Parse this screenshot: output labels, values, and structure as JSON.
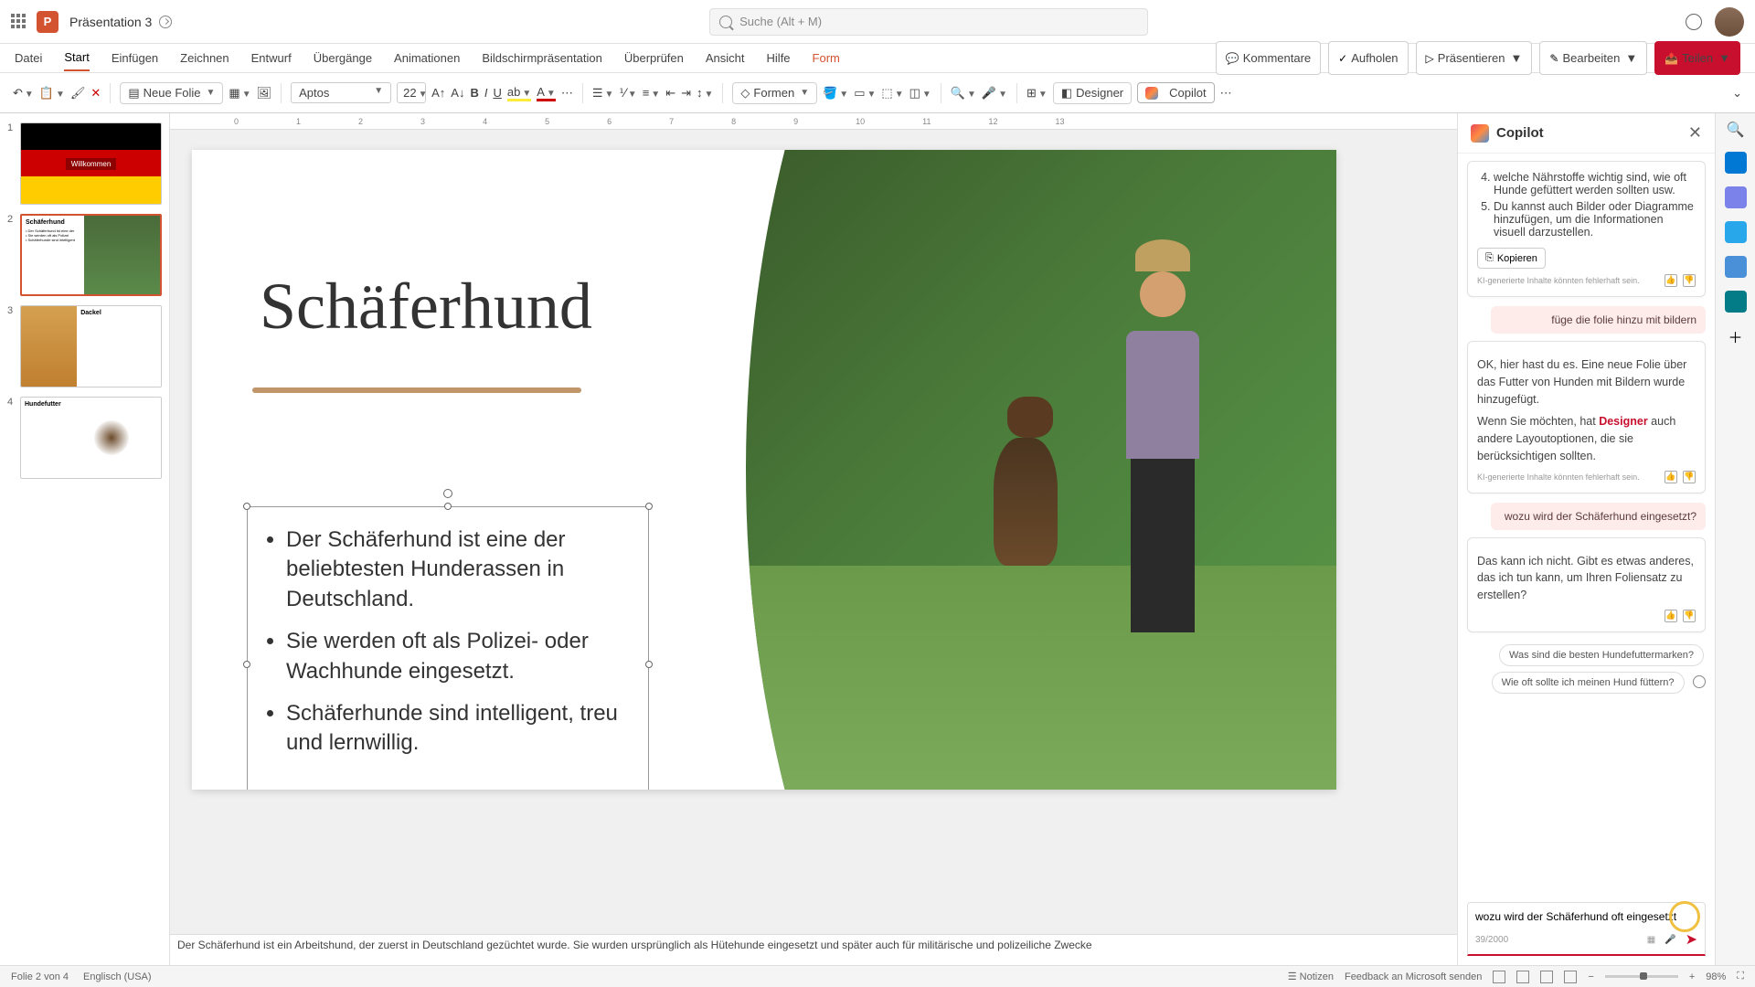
{
  "title": {
    "doc_name": "Präsentation 3",
    "search_placeholder": "Suche (Alt + M)"
  },
  "ribbon": {
    "tabs": [
      "Datei",
      "Start",
      "Einfügen",
      "Zeichnen",
      "Entwurf",
      "Übergänge",
      "Animationen",
      "Bildschirmpräsentation",
      "Überprüfen",
      "Ansicht",
      "Hilfe",
      "Form"
    ],
    "active_index": 1,
    "right": {
      "kommentare": "Kommentare",
      "aufholen": "Aufholen",
      "praesentieren": "Präsentieren",
      "bearbeiten": "Bearbeiten",
      "teilen": "Teilen"
    }
  },
  "toolbar": {
    "neue_folie": "Neue Folie",
    "font_name": "Aptos",
    "font_size": "22",
    "formen": "Formen",
    "designer": "Designer",
    "copilot": "Copilot"
  },
  "ruler": [
    "0",
    "1",
    "2",
    "3",
    "4",
    "5",
    "6",
    "7",
    "8",
    "9",
    "10",
    "11",
    "12",
    "13"
  ],
  "thumbs": {
    "t1": {
      "num": "1",
      "label": "Willkommen"
    },
    "t2": {
      "num": "2",
      "title": "Schäferhund"
    },
    "t3": {
      "num": "3",
      "title": "Dackel"
    },
    "t4": {
      "num": "4",
      "title": "Hundefutter"
    }
  },
  "slide": {
    "title": "Schäferhund",
    "bullets": [
      "Der Schäferhund ist eine der beliebtesten Hunderassen in Deutschland.",
      "Sie werden oft als Polizei- oder Wachhunde eingesetzt.",
      "Schäferhunde sind intelligent, treu und lernwillig."
    ],
    "notes": "Der Schäferhund ist ein Arbeitshund, der zuerst in Deutschland gezüchtet wurde. Sie wurden ursprünglich als Hütehunde eingesetzt und später auch für militärische und polizeiliche Zwecke"
  },
  "copilot": {
    "title": "Copilot",
    "list_item_4": "welche Nährstoffe wichtig sind, wie oft Hunde gefüttert werden sollten usw.",
    "list_item_5": "Du kannst auch Bilder oder Diagramme hinzufügen, um die Informationen visuell darzustellen.",
    "kopieren": "Kopieren",
    "disclaimer": "KI-generierte Inhalte könnten fehlerhaft sein.",
    "user1": "füge die folie hinzu mit bildern",
    "resp1a": "OK, hier hast du es. Eine neue Folie über das Futter von Hunden mit Bildern wurde hinzugefügt.",
    "resp1b_pre": "Wenn Sie möchten, hat ",
    "resp1b_link": "Designer",
    "resp1b_post": " auch andere Layoutoptionen, die sie berücksichtigen sollten.",
    "user2": "wozu wird der Schäferhund eingesetzt?",
    "resp2": "Das kann ich nicht. Gibt es etwas anderes, das ich tun kann, um Ihren Foliensatz zu erstellen?",
    "sugg1": "Was sind die besten Hundefuttermarken?",
    "sugg2": "Wie oft sollte ich meinen Hund füttern?",
    "input_value": "wozu wird der Schäferhund oft eingesetzt",
    "counter": "39/2000"
  },
  "status": {
    "slide_info": "Folie 2 von 4",
    "lang": "Englisch (USA)",
    "notizen": "Notizen",
    "feedback": "Feedback an Microsoft senden",
    "zoom": "98%"
  }
}
